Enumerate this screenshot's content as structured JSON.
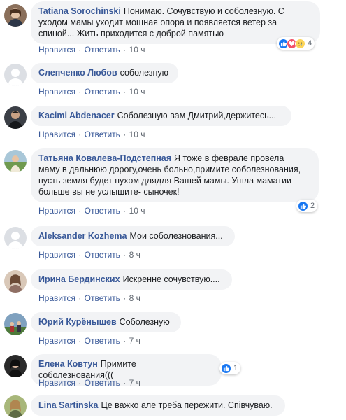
{
  "actions": {
    "like": "Нравится",
    "reply": "Ответить",
    "sep": "·"
  },
  "colors": {
    "link": "#385898",
    "bubble": "#f2f3f5",
    "like_blue": "#1877f2",
    "love_red": "#f25268",
    "sad_yellow": "#fcd55a"
  },
  "comments": [
    {
      "author": "Tatiana Sorochinski",
      "lines": [
        "Понимаю. Сочувствую и соболезную. С",
        "уходом мамы уходит мощная опора и появляется ветер за",
        "спиной... Жить приходится с доброй памятью"
      ],
      "time": "10 ч",
      "reactions": {
        "icons": [
          "like-icon",
          "love-icon",
          "sad-icon"
        ],
        "count": "4"
      }
    },
    {
      "author": "Слепченко Любов",
      "lines": [
        "соболезную"
      ],
      "time": "10 ч"
    },
    {
      "author": "Kacimi Abdenacer",
      "lines": [
        "Соболезную вам Дмитрий,держитесь..."
      ],
      "time": "10 ч"
    },
    {
      "author": "Татьяна Ковалева-Подстепная",
      "lines": [
        "Я тоже в феврале провела",
        "маму в дальнюю дорогу,очень больно,примите соболезнования,",
        "пусть земля будет пухом длядля Вашей мамы. Ушла маматии",
        "больше вы не услышите- сыночек!"
      ],
      "time": "10 ч",
      "reactions": {
        "icons": [
          "like-icon"
        ],
        "count": "2"
      }
    },
    {
      "author": "Aleksander Kozhema",
      "lines": [
        "Мои соболезнования..."
      ],
      "time": "8 ч"
    },
    {
      "author": "Ирина Бердинских",
      "lines": [
        "Искренне сочувствую...."
      ],
      "time": "8 ч"
    },
    {
      "author": "Юрий Курёнышев",
      "lines": [
        "Соболезную"
      ],
      "time": "7 ч"
    },
    {
      "author": "Елена Ковтун",
      "lines": [
        "Примите соболезнования((("
      ],
      "time": "7 ч",
      "reactions": {
        "icons": [
          "like-icon"
        ],
        "count": "1"
      }
    },
    {
      "author": "Lina Sartinska",
      "lines": [
        "Це важко але треба пережити. Співчуваю."
      ],
      "time": ""
    }
  ]
}
